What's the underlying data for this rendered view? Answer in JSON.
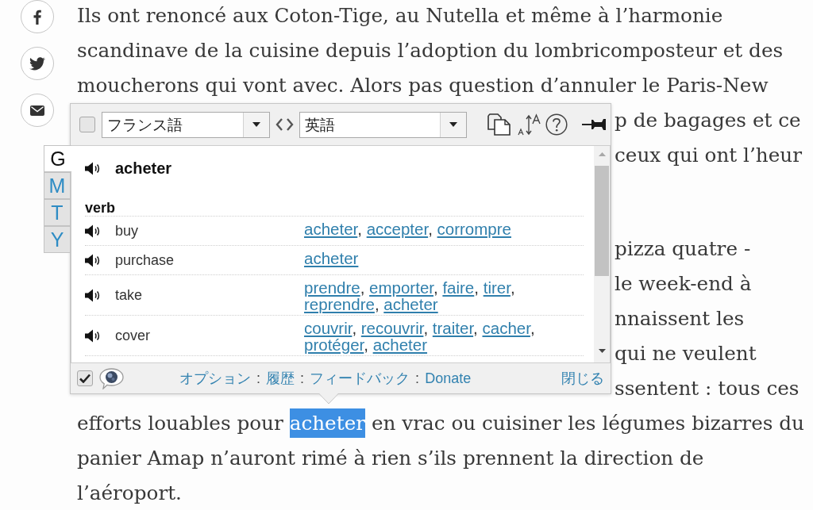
{
  "article": {
    "paragraphs": [
      {
        "parts": [
          {
            "kind": "full",
            "lines": [
              {
                "segments": [
                  {
                    "text": "Ils ont renoncé aux Coton-Tige, au Nutella et même à l’harmonie",
                    "highlighted": false
                  }
                ]
              },
              {
                "segments": [
                  {
                    "text": "scandinave de la cuisine depuis l’adoption du lombricomposteur et des",
                    "highlighted": false
                  }
                ]
              },
              {
                "segments": [
                  {
                    "text": "moucherons qui vont avec. Alors pas question d’annuler le Paris-New",
                    "highlighted": false
                  }
                ]
              }
            ]
          },
          {
            "kind": "beside_popup",
            "lines": [
              {
                "segments": [
                  {
                    "text": "p de bagages et ce",
                    "highlighted": false
                  }
                ]
              },
              {
                "segments": [
                  {
                    "text": "ceux qui ont l’heur",
                    "highlighted": false
                  }
                ]
              }
            ]
          }
        ]
      },
      {
        "parts": [
          {
            "kind": "beside_popup",
            "lines": [
              {
                "segments": [
                  {
                    "text": "pizza quatre -",
                    "highlighted": false
                  }
                ]
              },
              {
                "segments": [
                  {
                    "text": "le week-end à",
                    "highlighted": false
                  }
                ]
              },
              {
                "segments": [
                  {
                    "text": "nnaissent les",
                    "highlighted": false
                  }
                ]
              },
              {
                "segments": [
                  {
                    "text": "qui ne veulent",
                    "highlighted": false
                  }
                ]
              },
              {
                "segments": [
                  {
                    "text": "ssentent : tous ces",
                    "highlighted": false
                  }
                ]
              }
            ]
          },
          {
            "kind": "full",
            "lines": [
              {
                "segments": [
                  {
                    "text": "efforts louables pour ",
                    "highlighted": false
                  },
                  {
                    "text": "acheter",
                    "highlighted": true
                  },
                  {
                    "text": " en vrac ou cuisiner les légumes bizarres du",
                    "highlighted": false
                  }
                ]
              },
              {
                "segments": [
                  {
                    "text": "panier Amap n’auront rimé à rien s’ils prennent la direction de",
                    "highlighted": false
                  }
                ]
              },
              {
                "segments": [
                  {
                    "text": "l’aéroport.",
                    "highlighted": false
                  }
                ]
              }
            ]
          }
        ]
      }
    ]
  },
  "popup": {
    "toolbar": {
      "checkbox": {
        "checked": false
      },
      "source_language": "フランス語",
      "target_language": "英語"
    },
    "engine_tabs": [
      {
        "label": "G",
        "selected": true
      },
      {
        "label": "M",
        "selected": false
      },
      {
        "label": "T",
        "selected": false
      },
      {
        "label": "Y",
        "selected": false
      }
    ],
    "result": {
      "headword": "acheter",
      "part_of_speech": "verb",
      "entries": [
        {
          "word": "buy",
          "translations": [
            {
              "text": "acheter",
              "separator": ","
            },
            {
              "text": "accepter",
              "separator": ","
            },
            {
              "text": "corrompre"
            }
          ]
        },
        {
          "word": "purchase",
          "translations": [
            {
              "text": "acheter"
            }
          ]
        },
        {
          "word": "take",
          "translations": [
            {
              "text": "prendre",
              "separator": ","
            },
            {
              "text": "emporter",
              "separator": ","
            },
            {
              "text": "faire",
              "separator": ","
            },
            {
              "text": "tirer",
              "separator": ","
            },
            {
              "text": "reprendre",
              "separator": ","
            },
            {
              "text": "acheter"
            }
          ]
        },
        {
          "word": "cover",
          "translations": [
            {
              "text": "couvrir",
              "separator": ","
            },
            {
              "text": "recouvrir",
              "separator": ","
            },
            {
              "text": "traiter",
              "separator": ","
            },
            {
              "text": "cacher",
              "separator": ","
            },
            {
              "text": "protéger",
              "separator": ","
            },
            {
              "text": "acheter"
            }
          ]
        }
      ]
    },
    "footer": {
      "checkbox": {
        "checked": true
      },
      "links": [
        {
          "label": "オプション",
          "separator": ":"
        },
        {
          "label": "履歴",
          "separator": ":"
        },
        {
          "label": "フィードバック",
          "separator": ":"
        },
        {
          "label": "Donate"
        }
      ],
      "close": "閉じる"
    }
  }
}
